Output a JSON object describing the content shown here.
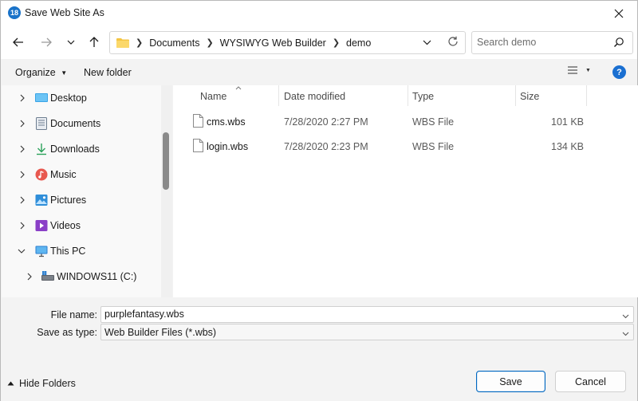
{
  "window": {
    "title": "Save Web Site As",
    "app_icon_text": "18"
  },
  "navigation": {
    "breadcrumbs": [
      "Documents",
      "WYSIWYG Web Builder",
      "demo"
    ],
    "search_placeholder": "Search demo"
  },
  "commands": {
    "organize_label": "Organize",
    "new_folder_label": "New folder",
    "help_label": "?"
  },
  "nav_pane": {
    "items": [
      {
        "label": "Desktop",
        "icon": "desktop-icon",
        "expanded": false
      },
      {
        "label": "Documents",
        "icon": "documents-icon",
        "expanded": false
      },
      {
        "label": "Downloads",
        "icon": "downloads-icon",
        "expanded": false
      },
      {
        "label": "Music",
        "icon": "music-icon",
        "expanded": false
      },
      {
        "label": "Pictures",
        "icon": "pictures-icon",
        "expanded": false
      },
      {
        "label": "Videos",
        "icon": "videos-icon",
        "expanded": false
      },
      {
        "label": "This PC",
        "icon": "pc-icon",
        "expanded": true
      },
      {
        "label": "WINDOWS11 (C:)",
        "icon": "drive-icon",
        "expanded": false
      }
    ]
  },
  "file_list": {
    "columns": [
      "Name",
      "Date modified",
      "Type",
      "Size"
    ],
    "sort_column": "Name",
    "rows": [
      {
        "name": "cms.wbs",
        "date": "7/28/2020 2:27 PM",
        "type": "WBS File",
        "size": "101 KB"
      },
      {
        "name": "login.wbs",
        "date": "7/28/2020 2:23 PM",
        "type": "WBS File",
        "size": "134 KB"
      }
    ]
  },
  "form": {
    "file_name_label": "File name:",
    "file_name_value": "purplefantasy.wbs",
    "save_type_label": "Save as type:",
    "save_type_value": "Web Builder Files (*.wbs)"
  },
  "footer": {
    "hide_folders_label": "Hide Folders",
    "save_label": "Save",
    "cancel_label": "Cancel"
  },
  "colors": {
    "accent": "#0067c0",
    "help": "#1a6fd1",
    "folder": "#f4c542"
  }
}
